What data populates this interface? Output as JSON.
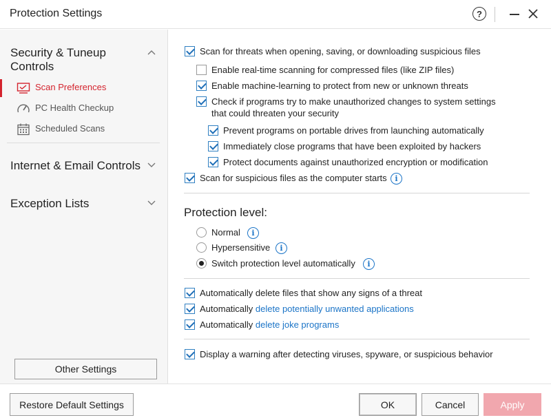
{
  "window": {
    "title": "Protection Settings",
    "help_glyph": "?",
    "close_glyph": "×"
  },
  "sidebar": {
    "categories": [
      {
        "label": "Security & Tuneup Controls",
        "items": [
          {
            "label": "Scan Preferences",
            "icon": "monitor-scan-icon",
            "active": true
          },
          {
            "label": "PC Health Checkup",
            "icon": "gauge-icon",
            "active": false
          },
          {
            "label": "Scheduled Scans",
            "icon": "calendar-icon",
            "active": false
          }
        ]
      },
      {
        "label": "Internet & Email Controls"
      },
      {
        "label": "Exception Lists"
      }
    ],
    "other_settings_label": "Other Settings"
  },
  "options": {
    "scan_on_access": {
      "label": "Scan for threats when opening, saving, or downloading suspicious files",
      "checked": true
    },
    "compressed": {
      "label": "Enable real-time scanning for compressed files (like ZIP files)",
      "checked": false
    },
    "ml": {
      "label": "Enable machine-learning to protect from new or unknown threats",
      "checked": true
    },
    "unauthorized_line1": "Check if programs try to make unauthorized changes to system settings",
    "unauthorized_line2": "that could threaten your security",
    "unauthorized_checked": true,
    "portable": {
      "label": "Prevent programs on portable drives from launching automatically",
      "checked": true
    },
    "exploited": {
      "label": "Immediately close programs that have been exploited by hackers",
      "checked": true
    },
    "encryption": {
      "label": "Protect documents against unauthorized encryption or modification",
      "checked": true
    },
    "startup": {
      "label": "Scan for suspicious files as the computer starts",
      "checked": true
    }
  },
  "protection_level": {
    "title": "Protection level:",
    "options": [
      {
        "label": "Normal",
        "selected": false
      },
      {
        "label": "Hypersensitive",
        "selected": false
      },
      {
        "label": "Switch protection level automatically",
        "selected": true
      }
    ]
  },
  "auto_actions": {
    "delete_threats": {
      "label": "Automatically delete files that show any signs of a threat",
      "checked": true
    },
    "pua_prefix": "Automatically ",
    "pua_link": "delete potentially unwanted applications",
    "joke_prefix": "Automatically ",
    "joke_link": "delete joke programs"
  },
  "warning": {
    "label": "Display a warning after detecting viruses, spyware, or suspicious behavior",
    "checked": true
  },
  "info_glyph": "i",
  "footer": {
    "restore_label": "Restore Default Settings",
    "ok_label": "OK",
    "cancel_label": "Cancel",
    "apply_label": "Apply"
  },
  "colors": {
    "accent_red": "#d4242e",
    "link_blue": "#1b74c7",
    "apply_disabled": "#f1a7ae"
  }
}
